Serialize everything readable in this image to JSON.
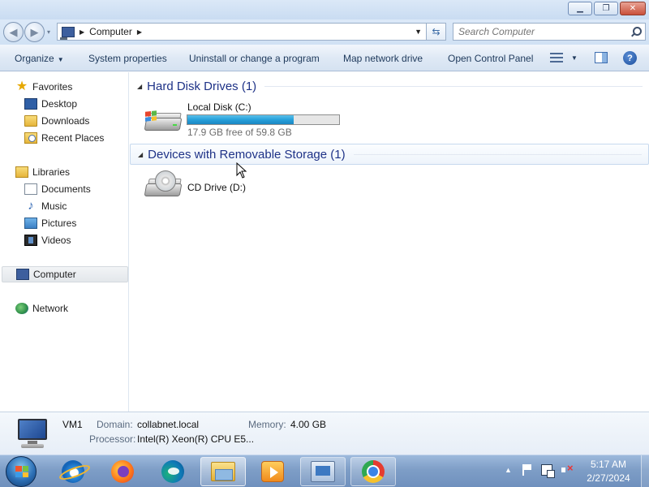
{
  "window": {
    "minimize_glyph": "▁",
    "maximize_glyph": "❐",
    "close_glyph": "✕"
  },
  "address_bar": {
    "back_glyph": "◀",
    "forward_glyph": "▶",
    "recent_glyph": "▾",
    "crumb_separator": "▶",
    "location": "Computer",
    "trailing_arrow": "▶",
    "dropdown_glyph": "▼",
    "refresh_glyph": "⇆"
  },
  "search": {
    "placeholder": "Search Computer"
  },
  "toolbar": {
    "organize": "Organize",
    "organize_caret": "▼",
    "system_properties": "System properties",
    "uninstall": "Uninstall or change a program",
    "map_drive": "Map network drive",
    "control_panel": "Open Control Panel",
    "views_caret": "▼",
    "help_glyph": "?"
  },
  "navigation": {
    "favorites": {
      "label": "Favorites",
      "items": [
        {
          "label": "Desktop",
          "icon": "desktop-icon"
        },
        {
          "label": "Downloads",
          "icon": "downloads-folder-icon"
        },
        {
          "label": "Recent Places",
          "icon": "recent-places-icon"
        }
      ]
    },
    "libraries": {
      "label": "Libraries",
      "items": [
        {
          "label": "Documents",
          "icon": "documents-icon"
        },
        {
          "label": "Music",
          "icon": "music-icon"
        },
        {
          "label": "Pictures",
          "icon": "pictures-icon"
        },
        {
          "label": "Videos",
          "icon": "videos-icon"
        }
      ]
    },
    "computer": {
      "label": "Computer",
      "selected": true
    },
    "network": {
      "label": "Network"
    },
    "star_glyph": "★",
    "music_glyph": "♪"
  },
  "content": {
    "groups": [
      {
        "title": "Hard Disk Drives (1)",
        "collapse_glyph": "◢",
        "drives": [
          {
            "name": "Local Disk (C:)",
            "free_text": "17.9 GB free of 59.8 GB",
            "free_gb": 17.9,
            "total_gb": 59.8,
            "used_fraction": 0.7,
            "icon": "hard-disk-icon"
          }
        ]
      },
      {
        "title": "Devices with Removable Storage (1)",
        "collapse_glyph": "◢",
        "drives": [
          {
            "name": "CD Drive (D:)",
            "icon": "cd-drive-icon"
          }
        ]
      }
    ]
  },
  "details": {
    "name": "VM1",
    "domain_label": "Domain:",
    "domain": "collabnet.local",
    "memory_label": "Memory:",
    "memory": "4.00 GB",
    "processor_label": "Processor:",
    "processor": "Intel(R) Xeon(R) CPU E5..."
  },
  "taskbar": {
    "apps": [
      {
        "name": "internet-explorer"
      },
      {
        "name": "firefox"
      },
      {
        "name": "edge"
      },
      {
        "name": "windows-explorer",
        "state": "active"
      },
      {
        "name": "media-player"
      },
      {
        "name": "remote-desktop",
        "state": "open"
      },
      {
        "name": "chrome",
        "state": "open"
      }
    ],
    "tray_arrow": "▲",
    "time": "5:17 AM",
    "date": "2/27/2024"
  },
  "colors": {
    "group_title": "#1e3287",
    "usage_fill": "#26a0da",
    "toolbar_text": "#1e395b"
  }
}
